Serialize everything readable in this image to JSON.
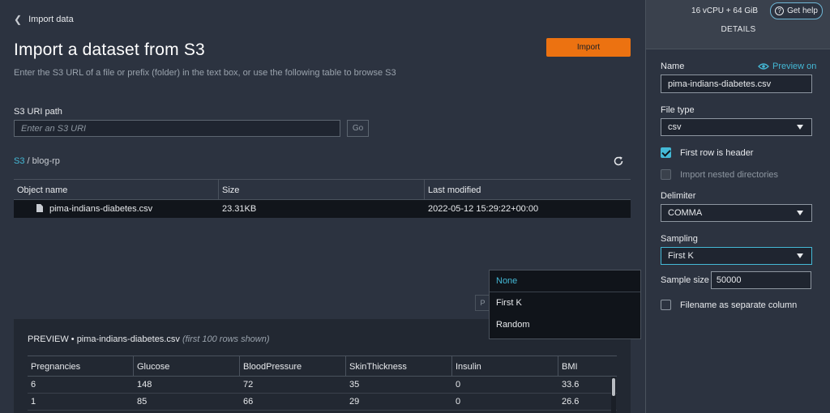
{
  "header": {
    "back_label": "Import data",
    "title": "Import a dataset from S3",
    "subtitle": "Enter the S3 URL of a file or prefix (folder) in the text box, or use the following table to browse S3",
    "import_label": "Import"
  },
  "s3uri": {
    "label": "S3 URI path",
    "placeholder": "Enter an S3 URI",
    "go_label": "Go"
  },
  "breadcrumb": {
    "root": "S3",
    "separator": "/",
    "current": "blog-rp"
  },
  "objects": {
    "columns": [
      "Object name",
      "Size",
      "Last modified"
    ],
    "rows": [
      {
        "name": "pima-indians-diabetes.csv",
        "size": "23.31KB",
        "modified": "2022-05-12 15:29:22+00:00"
      }
    ]
  },
  "pager_fragment": "P",
  "sampling_dropdown": {
    "options": [
      "None",
      "First K",
      "Random"
    ],
    "highlighted": "None"
  },
  "preview": {
    "label": "PREVIEW • pima-indians-diabetes.csv",
    "note": "(first 100 rows shown)",
    "columns": [
      "Pregnancies",
      "Glucose",
      "BloodPressure",
      "SkinThickness",
      "Insulin",
      "BMI"
    ],
    "rows": [
      [
        "6",
        "148",
        "72",
        "35",
        "0",
        "33.6"
      ],
      [
        "1",
        "85",
        "66",
        "29",
        "0",
        "26.6"
      ]
    ]
  },
  "sidebar": {
    "compute": "16 vCPU + 64 GiB",
    "help_label": "Get help",
    "details_label": "DETAILS",
    "name_label": "Name",
    "preview_toggle": "Preview on",
    "name_value": "pima-indians-diabetes.csv",
    "filetype_label": "File type",
    "filetype_value": "csv",
    "first_row_header": "First row is header",
    "first_row_checked": true,
    "nested_dirs": "Import nested directories",
    "nested_checked": false,
    "delimiter_label": "Delimiter",
    "delimiter_value": "COMMA",
    "sampling_label": "Sampling",
    "sampling_value": "First K",
    "sample_size_label": "Sample size",
    "sample_size_value": "50000",
    "filename_column": "Filename as separate column",
    "filename_checked": false
  },
  "colors": {
    "accent": "#44b9d6",
    "import_button": "#ec7211",
    "background": "#2c3340"
  },
  "icons": [
    "chevron-left-icon",
    "refresh-icon",
    "file-icon",
    "help-icon",
    "eye-icon",
    "caret-down-icon"
  ]
}
